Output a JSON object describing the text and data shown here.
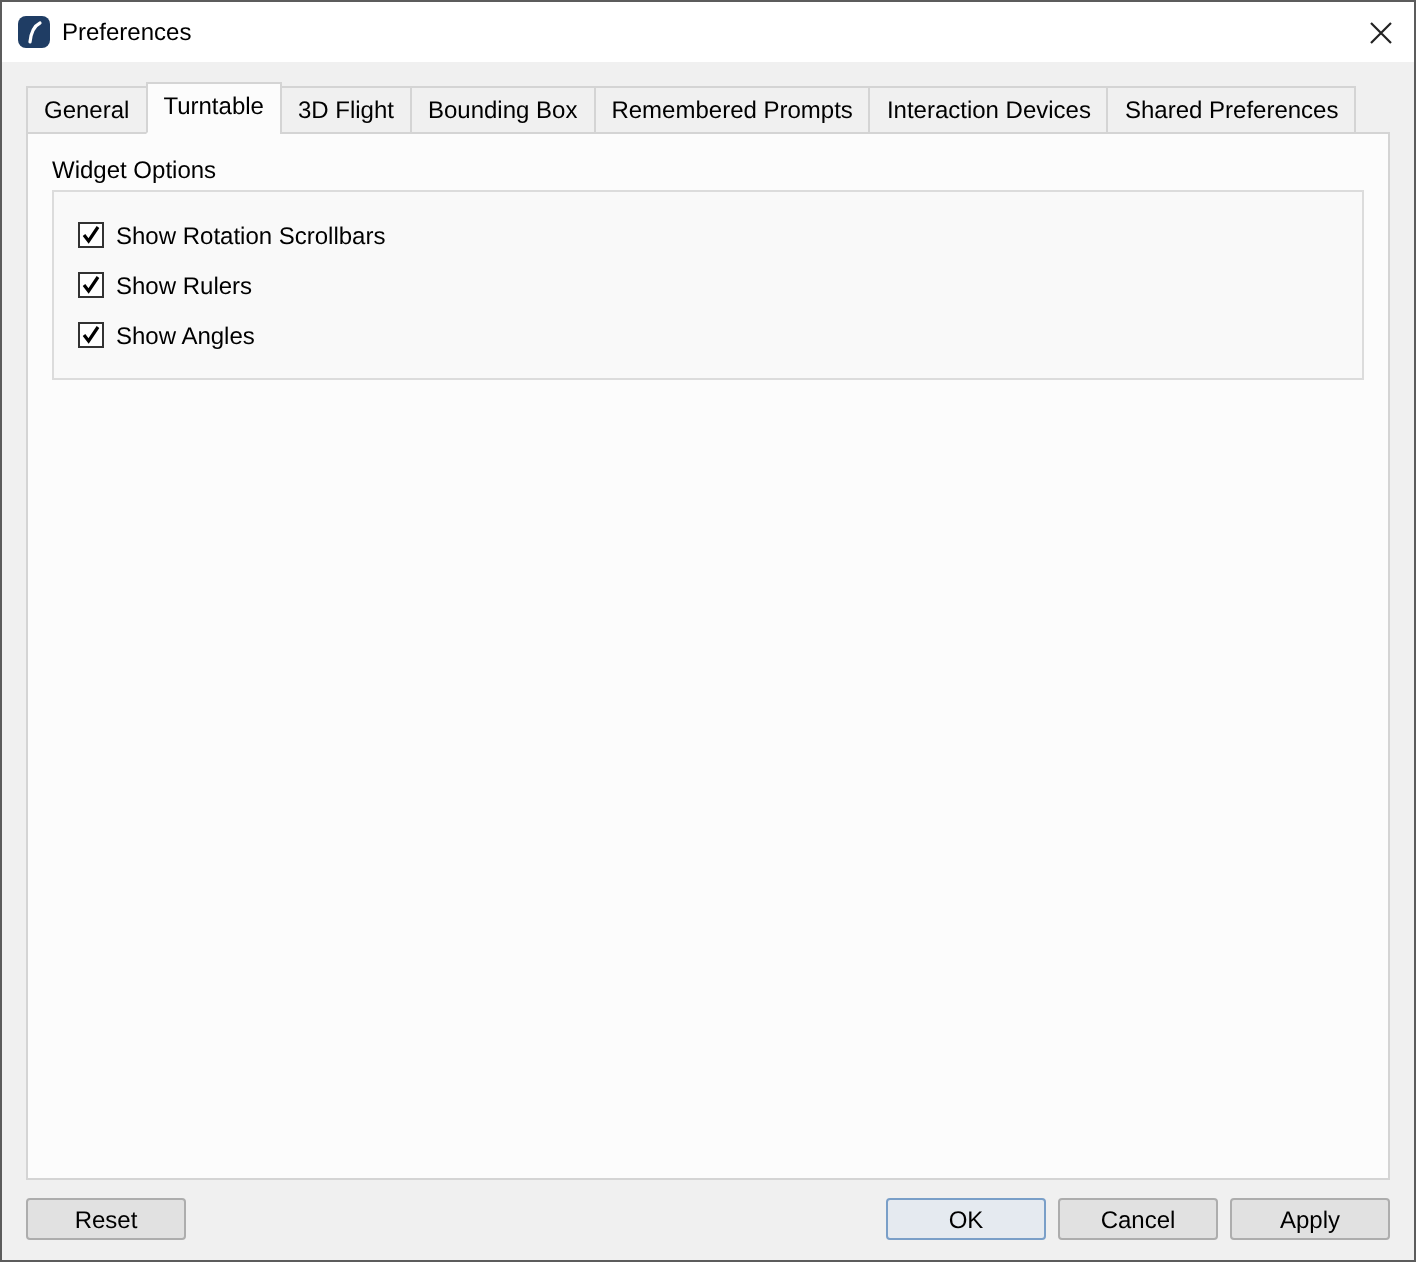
{
  "window": {
    "title": "Preferences"
  },
  "tabs": [
    {
      "label": "General",
      "selected": false
    },
    {
      "label": "Turntable",
      "selected": true
    },
    {
      "label": "3D Flight",
      "selected": false
    },
    {
      "label": "Bounding Box",
      "selected": false
    },
    {
      "label": "Remembered Prompts",
      "selected": false
    },
    {
      "label": "Interaction Devices",
      "selected": false
    },
    {
      "label": "Shared Preferences",
      "selected": false
    }
  ],
  "group": {
    "title": "Widget Options",
    "options": [
      {
        "label": "Show Rotation Scrollbars",
        "checked": true
      },
      {
        "label": "Show Rulers",
        "checked": true
      },
      {
        "label": "Show Angles",
        "checked": true
      }
    ]
  },
  "footer": {
    "left_buttons": [
      {
        "label": "Reset",
        "default": false
      }
    ],
    "right_buttons": [
      {
        "label": "OK",
        "default": true
      },
      {
        "label": "Cancel",
        "default": false
      },
      {
        "label": "Apply",
        "default": false
      }
    ]
  }
}
